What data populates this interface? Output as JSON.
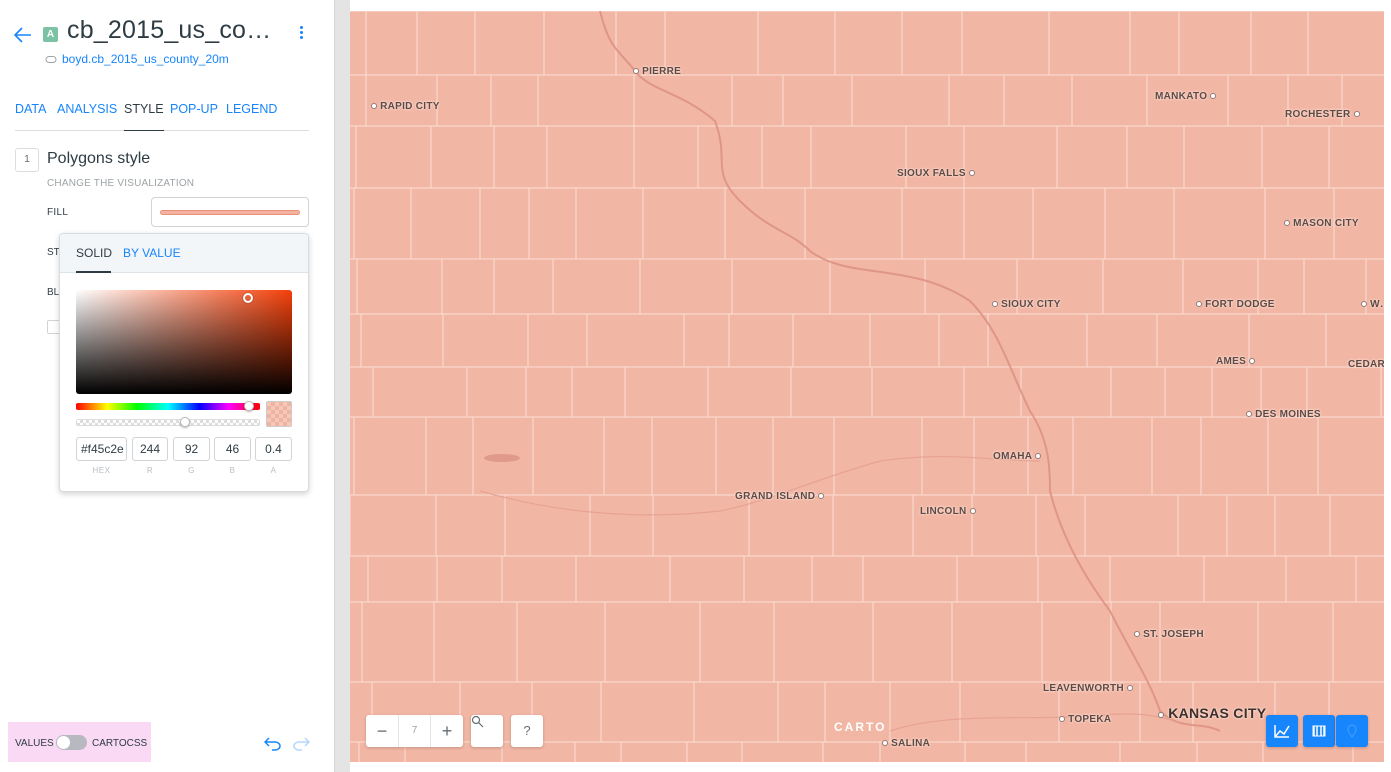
{
  "panel": {
    "layer_badge": "A",
    "layer_title": "cb_2015_us_co…",
    "source_link": "boyd.cb_2015_us_county_20m",
    "tabs": [
      "DATA",
      "ANALYSIS",
      "STYLE",
      "POP-UP",
      "LEGEND"
    ],
    "active_tab": "STYLE",
    "step_number": "1",
    "section_title": "Polygons style",
    "section_subtitle": "CHANGE THE VISUALIZATION",
    "fill_label": "FILL",
    "stroke_label_partial": "ST",
    "blending_label_partial": "BL"
  },
  "color_picker": {
    "tabs": [
      "SOLID",
      "BY VALUE"
    ],
    "active_tab": "SOLID",
    "hex": "#f45c2e",
    "r": "244",
    "g": "92",
    "b": "46",
    "a": "0.4",
    "labels": [
      "HEX",
      "R",
      "G",
      "B",
      "A"
    ],
    "hue_level": 0.94,
    "alpha_level": 0.4
  },
  "bottom": {
    "mode_values": "VALUES",
    "mode_cartocss": "CARTOCSS",
    "cartocss_enabled": false
  },
  "map": {
    "fill_color": "#f2b6a4",
    "cities": [
      {
        "name": "PIERRE",
        "big": false
      },
      {
        "name": "RAPID CITY",
        "big": false
      },
      {
        "name": "MANKATO",
        "big": false
      },
      {
        "name": "ROCHESTER",
        "big": false
      },
      {
        "name": "SIOUX FALLS",
        "big": false
      },
      {
        "name": "MASON CITY",
        "big": false
      },
      {
        "name": "SIOUX CITY",
        "big": false
      },
      {
        "name": "FORT DODGE",
        "big": false
      },
      {
        "name": "W…",
        "big": false
      },
      {
        "name": "AMES",
        "big": false
      },
      {
        "name": "CEDAR",
        "big": false
      },
      {
        "name": "DES MOINES",
        "big": false
      },
      {
        "name": "OMAHA",
        "big": false
      },
      {
        "name": "GRAND ISLAND",
        "big": false
      },
      {
        "name": "LINCOLN",
        "big": false
      },
      {
        "name": "ST. JOSEPH",
        "big": false
      },
      {
        "name": "LEAVENWORTH",
        "big": false
      },
      {
        "name": "TOPEKA",
        "big": false
      },
      {
        "name": "KANSAS CITY",
        "big": true
      },
      {
        "name": "SALINA",
        "big": false
      }
    ],
    "zoom_level": "7",
    "help_label": "?",
    "attribution": "CARTO"
  }
}
